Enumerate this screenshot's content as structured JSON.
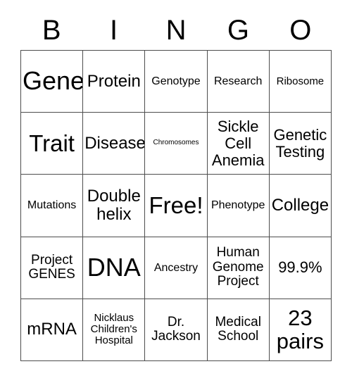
{
  "header": {
    "letters": [
      "B",
      "I",
      "N",
      "G",
      "O"
    ]
  },
  "grid": {
    "rows": 5,
    "columns": 5,
    "border_color": "#4d4d4d",
    "background_color": "#ffffff",
    "text_color": "#000000",
    "cells": [
      {
        "text": "Gene",
        "size": "fs-xxl"
      },
      {
        "text": "Protein",
        "size": "fs-md"
      },
      {
        "text": "Genotype",
        "size": "fs-xxs"
      },
      {
        "text": "Research",
        "size": "fs-xxs"
      },
      {
        "text": "Ribosome",
        "size": "fs-tiny"
      },
      {
        "text": "Trait",
        "size": "fs-xl"
      },
      {
        "text": "Disease",
        "size": "fs-md"
      },
      {
        "text": "Chromosomes",
        "size": "fs-mini"
      },
      {
        "text": "Sickle\nCell\nAnemia",
        "size": "fs-sm"
      },
      {
        "text": "Genetic\nTesting",
        "size": "fs-sm"
      },
      {
        "text": "Mutations",
        "size": "fs-xxs"
      },
      {
        "text": "Double\nhelix",
        "size": "fs-md"
      },
      {
        "text": "Free!",
        "size": "fs-xl"
      },
      {
        "text": "Phenotype",
        "size": "fs-xxs"
      },
      {
        "text": "College",
        "size": "fs-md"
      },
      {
        "text": "Project\nGENES",
        "size": "fs-xs"
      },
      {
        "text": "DNA",
        "size": "fs-xxl"
      },
      {
        "text": "Ancestry",
        "size": "fs-xxs"
      },
      {
        "text": "Human\nGenome\nProject",
        "size": "fs-xs"
      },
      {
        "text": "99.9%",
        "size": "fs-sm"
      },
      {
        "text": "mRNA",
        "size": "fs-md"
      },
      {
        "text": "Nicklaus\nChildren's\nHospital",
        "size": "fs-tiny"
      },
      {
        "text": "Dr.\nJackson",
        "size": "fs-xs"
      },
      {
        "text": "Medical\nSchool",
        "size": "fs-xs"
      },
      {
        "text": "23\npairs",
        "size": "fs-lg"
      }
    ]
  }
}
